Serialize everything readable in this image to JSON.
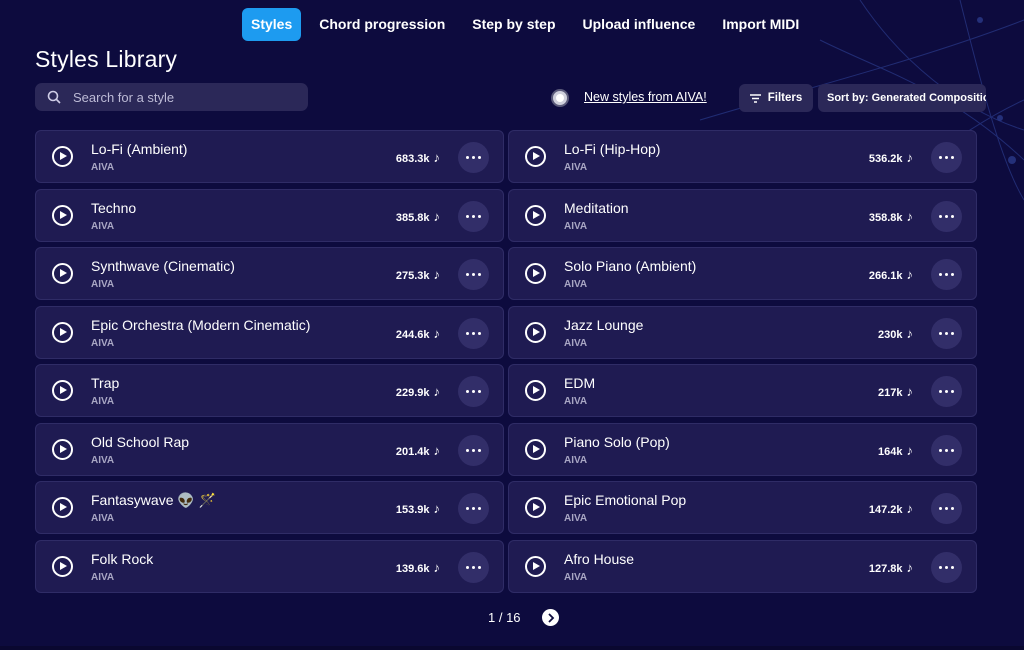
{
  "tabs": [
    {
      "label": "Styles",
      "active": true
    },
    {
      "label": "Chord progression"
    },
    {
      "label": "Step by step"
    },
    {
      "label": "Upload influence"
    },
    {
      "label": "Import MIDI"
    }
  ],
  "page_title": "Styles Library",
  "search": {
    "placeholder": "Search for a style",
    "value": ""
  },
  "new_styles_label": "New styles from AIVA!",
  "filters_label": "Filters",
  "sort_label": "Sort by: Generated Compositions",
  "colors": {
    "accent": "#1d9bf0",
    "background": "#0d0b3e",
    "card": "#1f1b52"
  },
  "styles": [
    {
      "name": "Lo-Fi (Ambient)",
      "author": "AIVA",
      "count": "683.3k"
    },
    {
      "name": "Lo-Fi (Hip-Hop)",
      "author": "AIVA",
      "count": "536.2k"
    },
    {
      "name": "Techno",
      "author": "AIVA",
      "count": "385.8k"
    },
    {
      "name": "Meditation",
      "author": "AIVA",
      "count": "358.8k"
    },
    {
      "name": "Synthwave (Cinematic)",
      "author": "AIVA",
      "count": "275.3k"
    },
    {
      "name": "Solo Piano (Ambient)",
      "author": "AIVA",
      "count": "266.1k"
    },
    {
      "name": "Epic Orchestra (Modern Cinematic)",
      "author": "AIVA",
      "count": "244.6k"
    },
    {
      "name": "Jazz Lounge",
      "author": "AIVA",
      "count": "230k"
    },
    {
      "name": "Trap",
      "author": "AIVA",
      "count": "229.9k"
    },
    {
      "name": "EDM",
      "author": "AIVA",
      "count": "217k"
    },
    {
      "name": "Old School Rap",
      "author": "AIVA",
      "count": "201.4k"
    },
    {
      "name": "Piano Solo (Pop)",
      "author": "AIVA",
      "count": "164k"
    },
    {
      "name": "Fantasywave 👽 🪄",
      "author": "AIVA",
      "count": "153.9k"
    },
    {
      "name": "Epic Emotional Pop",
      "author": "AIVA",
      "count": "147.2k"
    },
    {
      "name": "Folk Rock",
      "author": "AIVA",
      "count": "139.6k"
    },
    {
      "name": "Afro House",
      "author": "AIVA",
      "count": "127.8k"
    }
  ],
  "note_icon": "music-note-icon",
  "pagination": {
    "label": "1 / 16"
  }
}
